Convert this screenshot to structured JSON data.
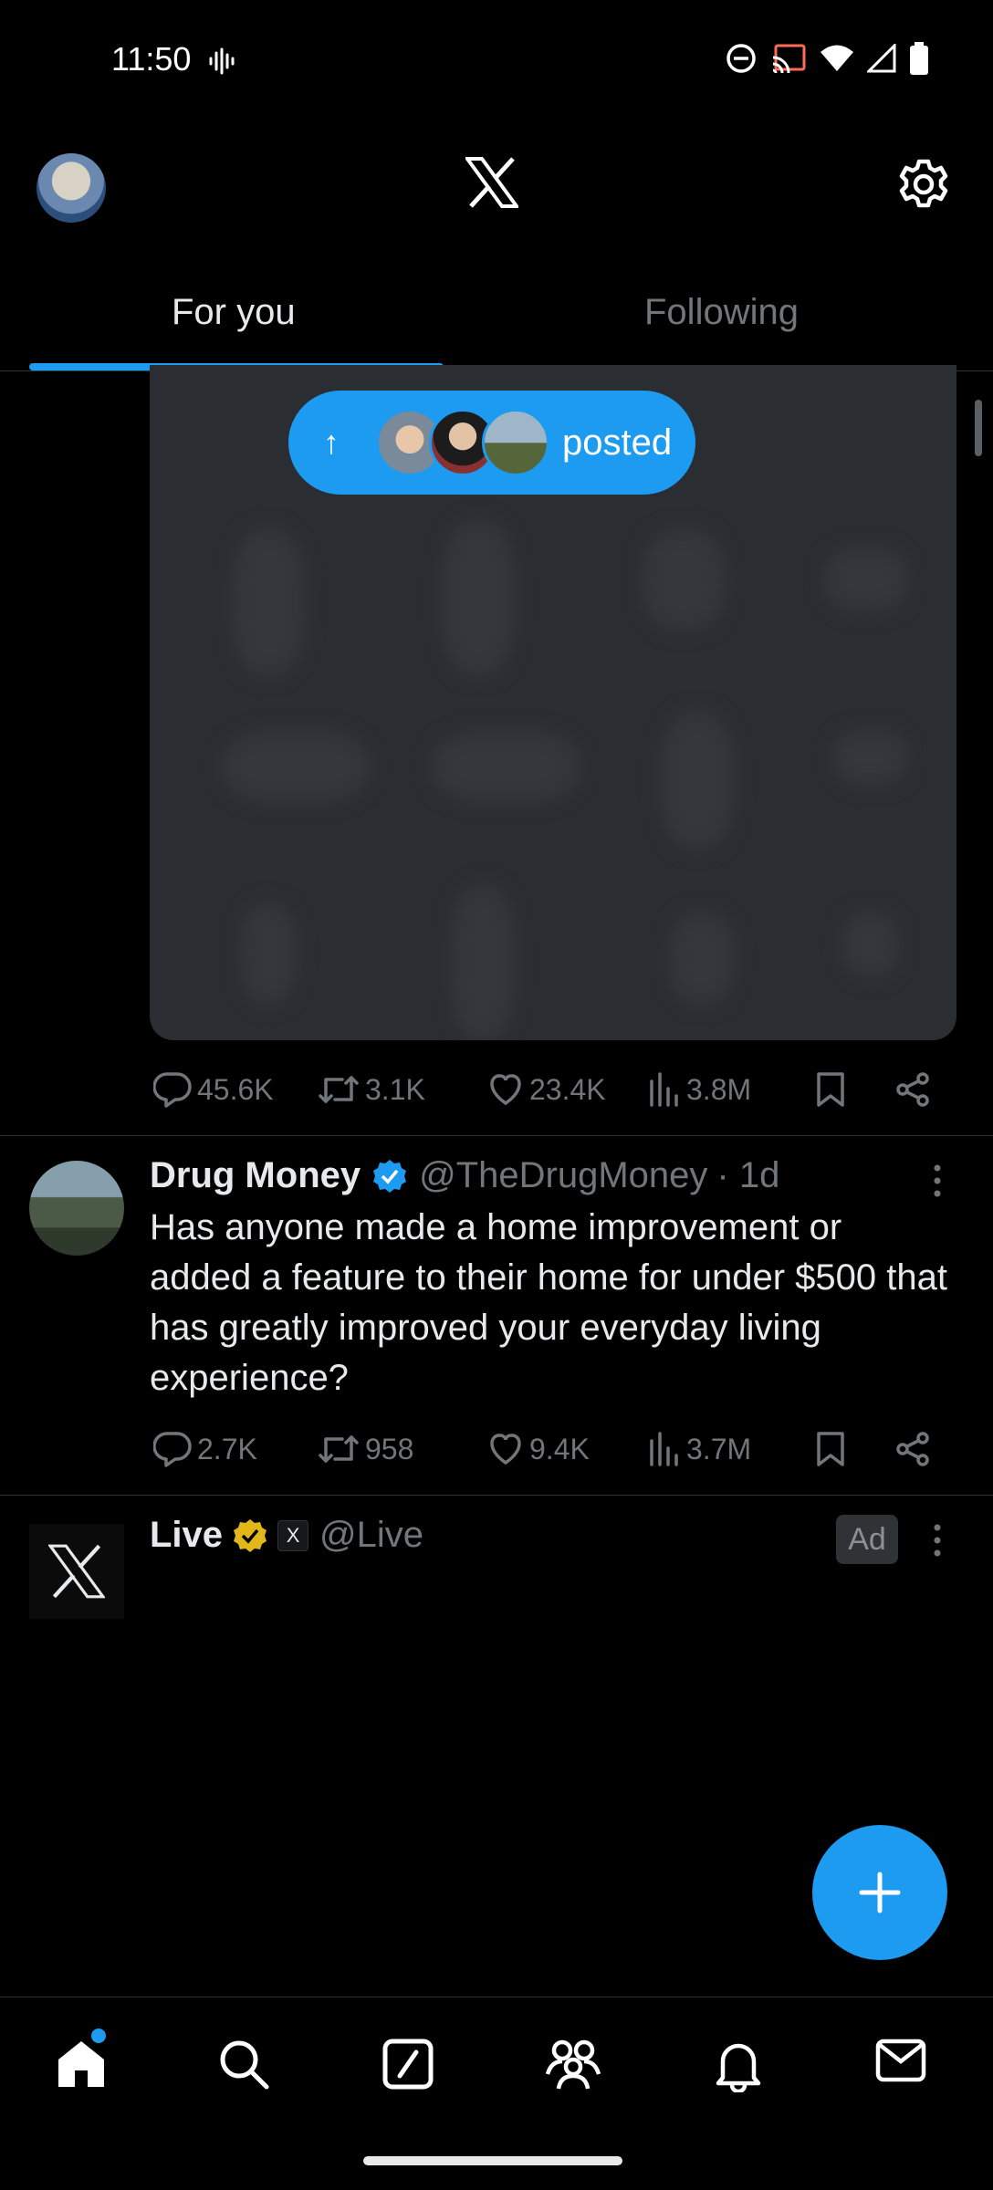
{
  "status_bar": {
    "time": "11:50",
    "icons": [
      "voice-activity-icon",
      "do-not-disturb-icon",
      "cast-icon",
      "wifi-icon",
      "signal-icon",
      "battery-icon"
    ]
  },
  "header": {
    "logo": "X",
    "tabs": [
      {
        "label": "For you",
        "selected": true
      },
      {
        "label": "Following",
        "selected": false
      }
    ]
  },
  "new_posts_pill": {
    "label": "posted",
    "avatar_count": 3
  },
  "posts": [
    {
      "stats": {
        "replies": "45.6K",
        "reposts": "3.1K",
        "likes": "23.4K",
        "views": "3.8M"
      }
    },
    {
      "name": "Drug Money",
      "verified": true,
      "handle": "@TheDrugMoney",
      "time": "· 1d",
      "text": "Has anyone made a home improvement or added a feature to their home for under $500 that has greatly improved your everyday living experience?",
      "stats": {
        "replies": "2.7K",
        "reposts": "958",
        "likes": "9.4K",
        "views": "3.7M"
      }
    },
    {
      "name": "Live",
      "verified": true,
      "affiliate_badge": "X",
      "handle": "@Live",
      "ad_label": "Ad"
    }
  ],
  "bottom_nav": [
    "home-icon",
    "search-icon",
    "grok-icon",
    "communities-icon",
    "notifications-icon",
    "messages-icon"
  ],
  "colors": {
    "accent": "#1d9bf0",
    "background": "#000000",
    "text_primary": "#e7e9ea",
    "text_secondary": "#71767b",
    "gold_badge": "#e2b719"
  }
}
